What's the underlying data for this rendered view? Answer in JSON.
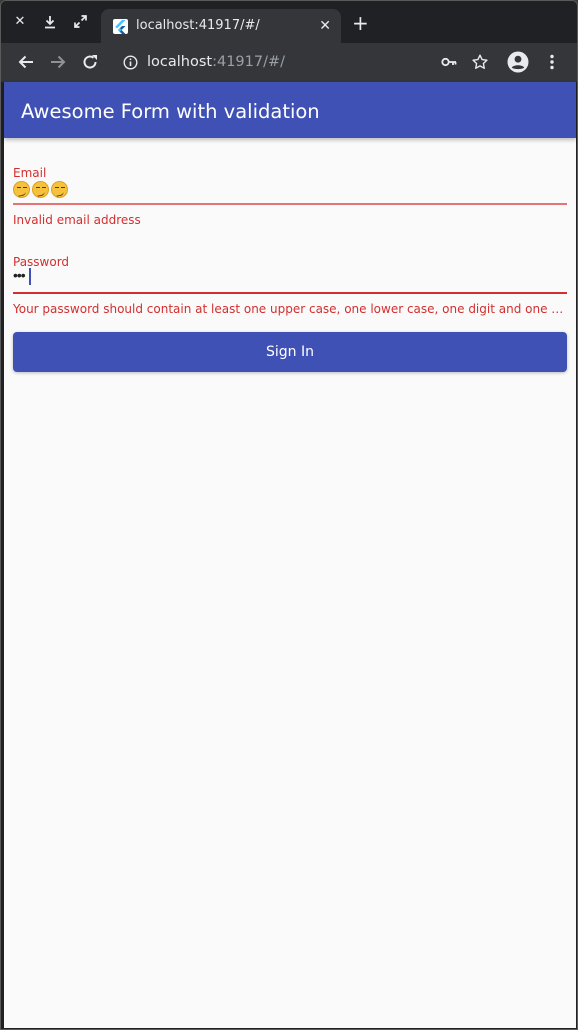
{
  "browser": {
    "tab_title": "localhost:41917/#/",
    "url_host": "localhost",
    "url_rest": ":41917/#/",
    "colors": {
      "tabstrip": "#202124",
      "toolbar": "#35363a",
      "text": "#e8eaed"
    }
  },
  "app": {
    "title": "Awesome Form with validation",
    "accent_color": "#3f51b5",
    "error_color": "#d32f2f"
  },
  "form": {
    "email": {
      "label": "Email",
      "value": "😏😏😏",
      "error": "Invalid email address"
    },
    "password": {
      "label": "Password",
      "value": "•••",
      "error": "Your password should contain at least one upper case, one lower case, one digit and one special …"
    },
    "submit_label": "Sign In"
  },
  "icons": {
    "close": "close-icon",
    "download": "download-icon",
    "maximize": "maximize-icon",
    "tab_favicon": "flutter-icon",
    "tab_close": "close-icon",
    "new_tab": "plus-icon",
    "back": "back-arrow-icon",
    "forward": "forward-arrow-icon",
    "reload": "reload-icon",
    "site_info": "info-icon",
    "password_key": "key-icon",
    "bookmark": "star-icon",
    "profile": "account-icon",
    "menu": "more-vert-icon"
  }
}
